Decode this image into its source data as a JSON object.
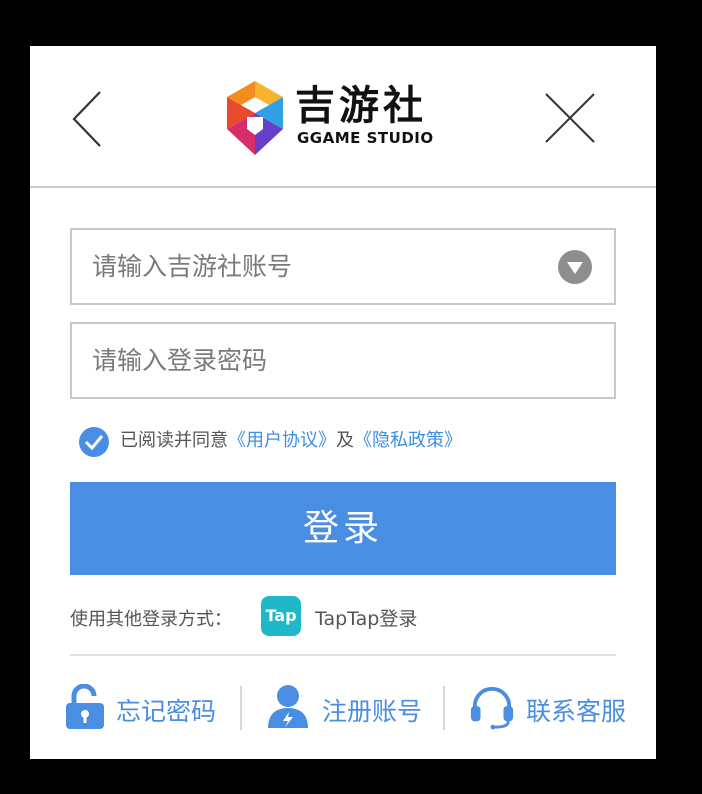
{
  "header": {
    "logo_title": "吉游社",
    "logo_subtitle": "GGAME STUDIO"
  },
  "form": {
    "account_placeholder": "请输入吉游社账号",
    "account_value": "",
    "password_placeholder": "请输入登录密码",
    "password_value": ""
  },
  "agreement": {
    "checked": true,
    "prefix": "已阅读并同意",
    "user_agreement": "《用户协议》",
    "conjunction": "及",
    "privacy_policy": "《隐私政策》"
  },
  "login_button": "登录",
  "other_login": {
    "label": "使用其他登录方式：",
    "tap_icon_text": "Tap",
    "tap_label": "TapTap登录"
  },
  "footer": {
    "forgot_password": "忘记密码",
    "register": "注册账号",
    "contact_support": "联系客服"
  },
  "colors": {
    "accent": "#4a8ee3",
    "link": "#3d8fe3",
    "taptap": "#1fb8c8"
  },
  "icons": [
    "back-arrow-icon",
    "close-icon",
    "dropdown-icon",
    "checkmark-icon",
    "taptap-icon",
    "unlock-icon",
    "user-icon",
    "headset-icon"
  ]
}
